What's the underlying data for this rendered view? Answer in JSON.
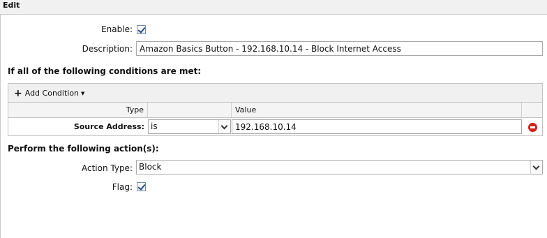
{
  "window": {
    "title": "Edit"
  },
  "form": {
    "enable_label": "Enable:",
    "enable_checked": true,
    "description_label": "Description:",
    "description_value": "Amazon Basics Button - 192.168.10.14 - Block Internet Access"
  },
  "conditions": {
    "section_title": "If all of the following conditions are met:",
    "add_condition_label": "Add Condition",
    "headers": {
      "type": "Type",
      "operator": "",
      "value": "Value"
    },
    "rows": [
      {
        "type": "Source Address:",
        "operator": "is",
        "value": "192.168.10.14"
      }
    ]
  },
  "actions": {
    "section_title": "Perform the following action(s):",
    "action_type_label": "Action Type:",
    "action_type_value": "Block",
    "flag_label": "Flag:",
    "flag_checked": true
  },
  "colors": {
    "remove": "#d42020",
    "toolbar_bg": "#f0f0f0",
    "border": "#c4c4c4"
  },
  "icons": {
    "add": "plus-icon",
    "remove": "remove-icon",
    "dropdown": "chevron-down-icon"
  }
}
